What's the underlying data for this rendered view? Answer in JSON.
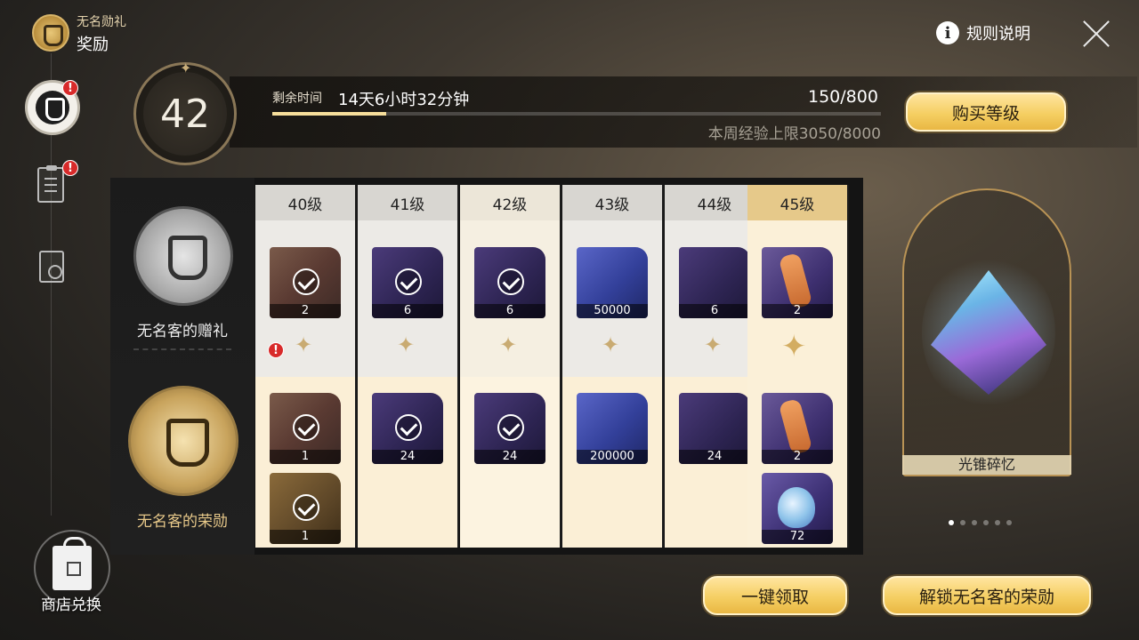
{
  "header": {
    "subtitle": "无名勋礼",
    "title": "奖励"
  },
  "rules": {
    "label": "规则说明"
  },
  "nav": {
    "shop_label": "商店兑换",
    "alert_mark": "!"
  },
  "level": {
    "current": "42"
  },
  "progress": {
    "remain_label": "剩余时间",
    "remain_value": "14天6小时32分钟",
    "exp_value": "150/800",
    "exp_fraction": 0.1875,
    "weekly_cap": "本周经验上限3050/8000"
  },
  "buttons": {
    "buy_level": "购买等级",
    "claim_all": "一键领取",
    "unlock": "解锁无名客的荣勋"
  },
  "tracks": {
    "free_label": "无名客的赠礼",
    "paid_label": "无名客的荣勋"
  },
  "columns": [
    {
      "level": "40级",
      "free": [
        {
          "qty": "2",
          "art": "red",
          "claimed": true
        }
      ],
      "paid": [
        {
          "qty": "1",
          "art": "red",
          "claimed": true
        },
        {
          "qty": "1",
          "art": "gold",
          "claimed": true
        }
      ]
    },
    {
      "level": "41级",
      "free": [
        {
          "qty": "6",
          "art": "purple",
          "claimed": true
        }
      ],
      "paid": [
        {
          "qty": "24",
          "art": "purple",
          "claimed": true
        }
      ]
    },
    {
      "level": "42级",
      "free": [
        {
          "qty": "6",
          "art": "purple",
          "claimed": true
        }
      ],
      "paid": [
        {
          "qty": "24",
          "art": "purple",
          "claimed": true
        }
      ]
    },
    {
      "level": "43级",
      "free": [
        {
          "qty": "50000",
          "art": "blue",
          "claimed": false
        }
      ],
      "paid": [
        {
          "qty": "200000",
          "art": "blue",
          "claimed": false
        }
      ]
    },
    {
      "level": "44级",
      "free": [
        {
          "qty": "6",
          "art": "purple",
          "claimed": false
        }
      ],
      "paid": [
        {
          "qty": "24",
          "art": "purple",
          "claimed": false
        }
      ]
    },
    {
      "level": "45级",
      "free": [
        {
          "qty": "2",
          "art": "figure",
          "claimed": false
        }
      ],
      "paid": [
        {
          "qty": "2",
          "art": "figure",
          "claimed": false
        },
        {
          "qty": "72",
          "art": "bottle",
          "claimed": false
        }
      ]
    }
  ],
  "showcase": {
    "label": "光锥碎忆",
    "page_index": 0,
    "page_count": 6
  }
}
